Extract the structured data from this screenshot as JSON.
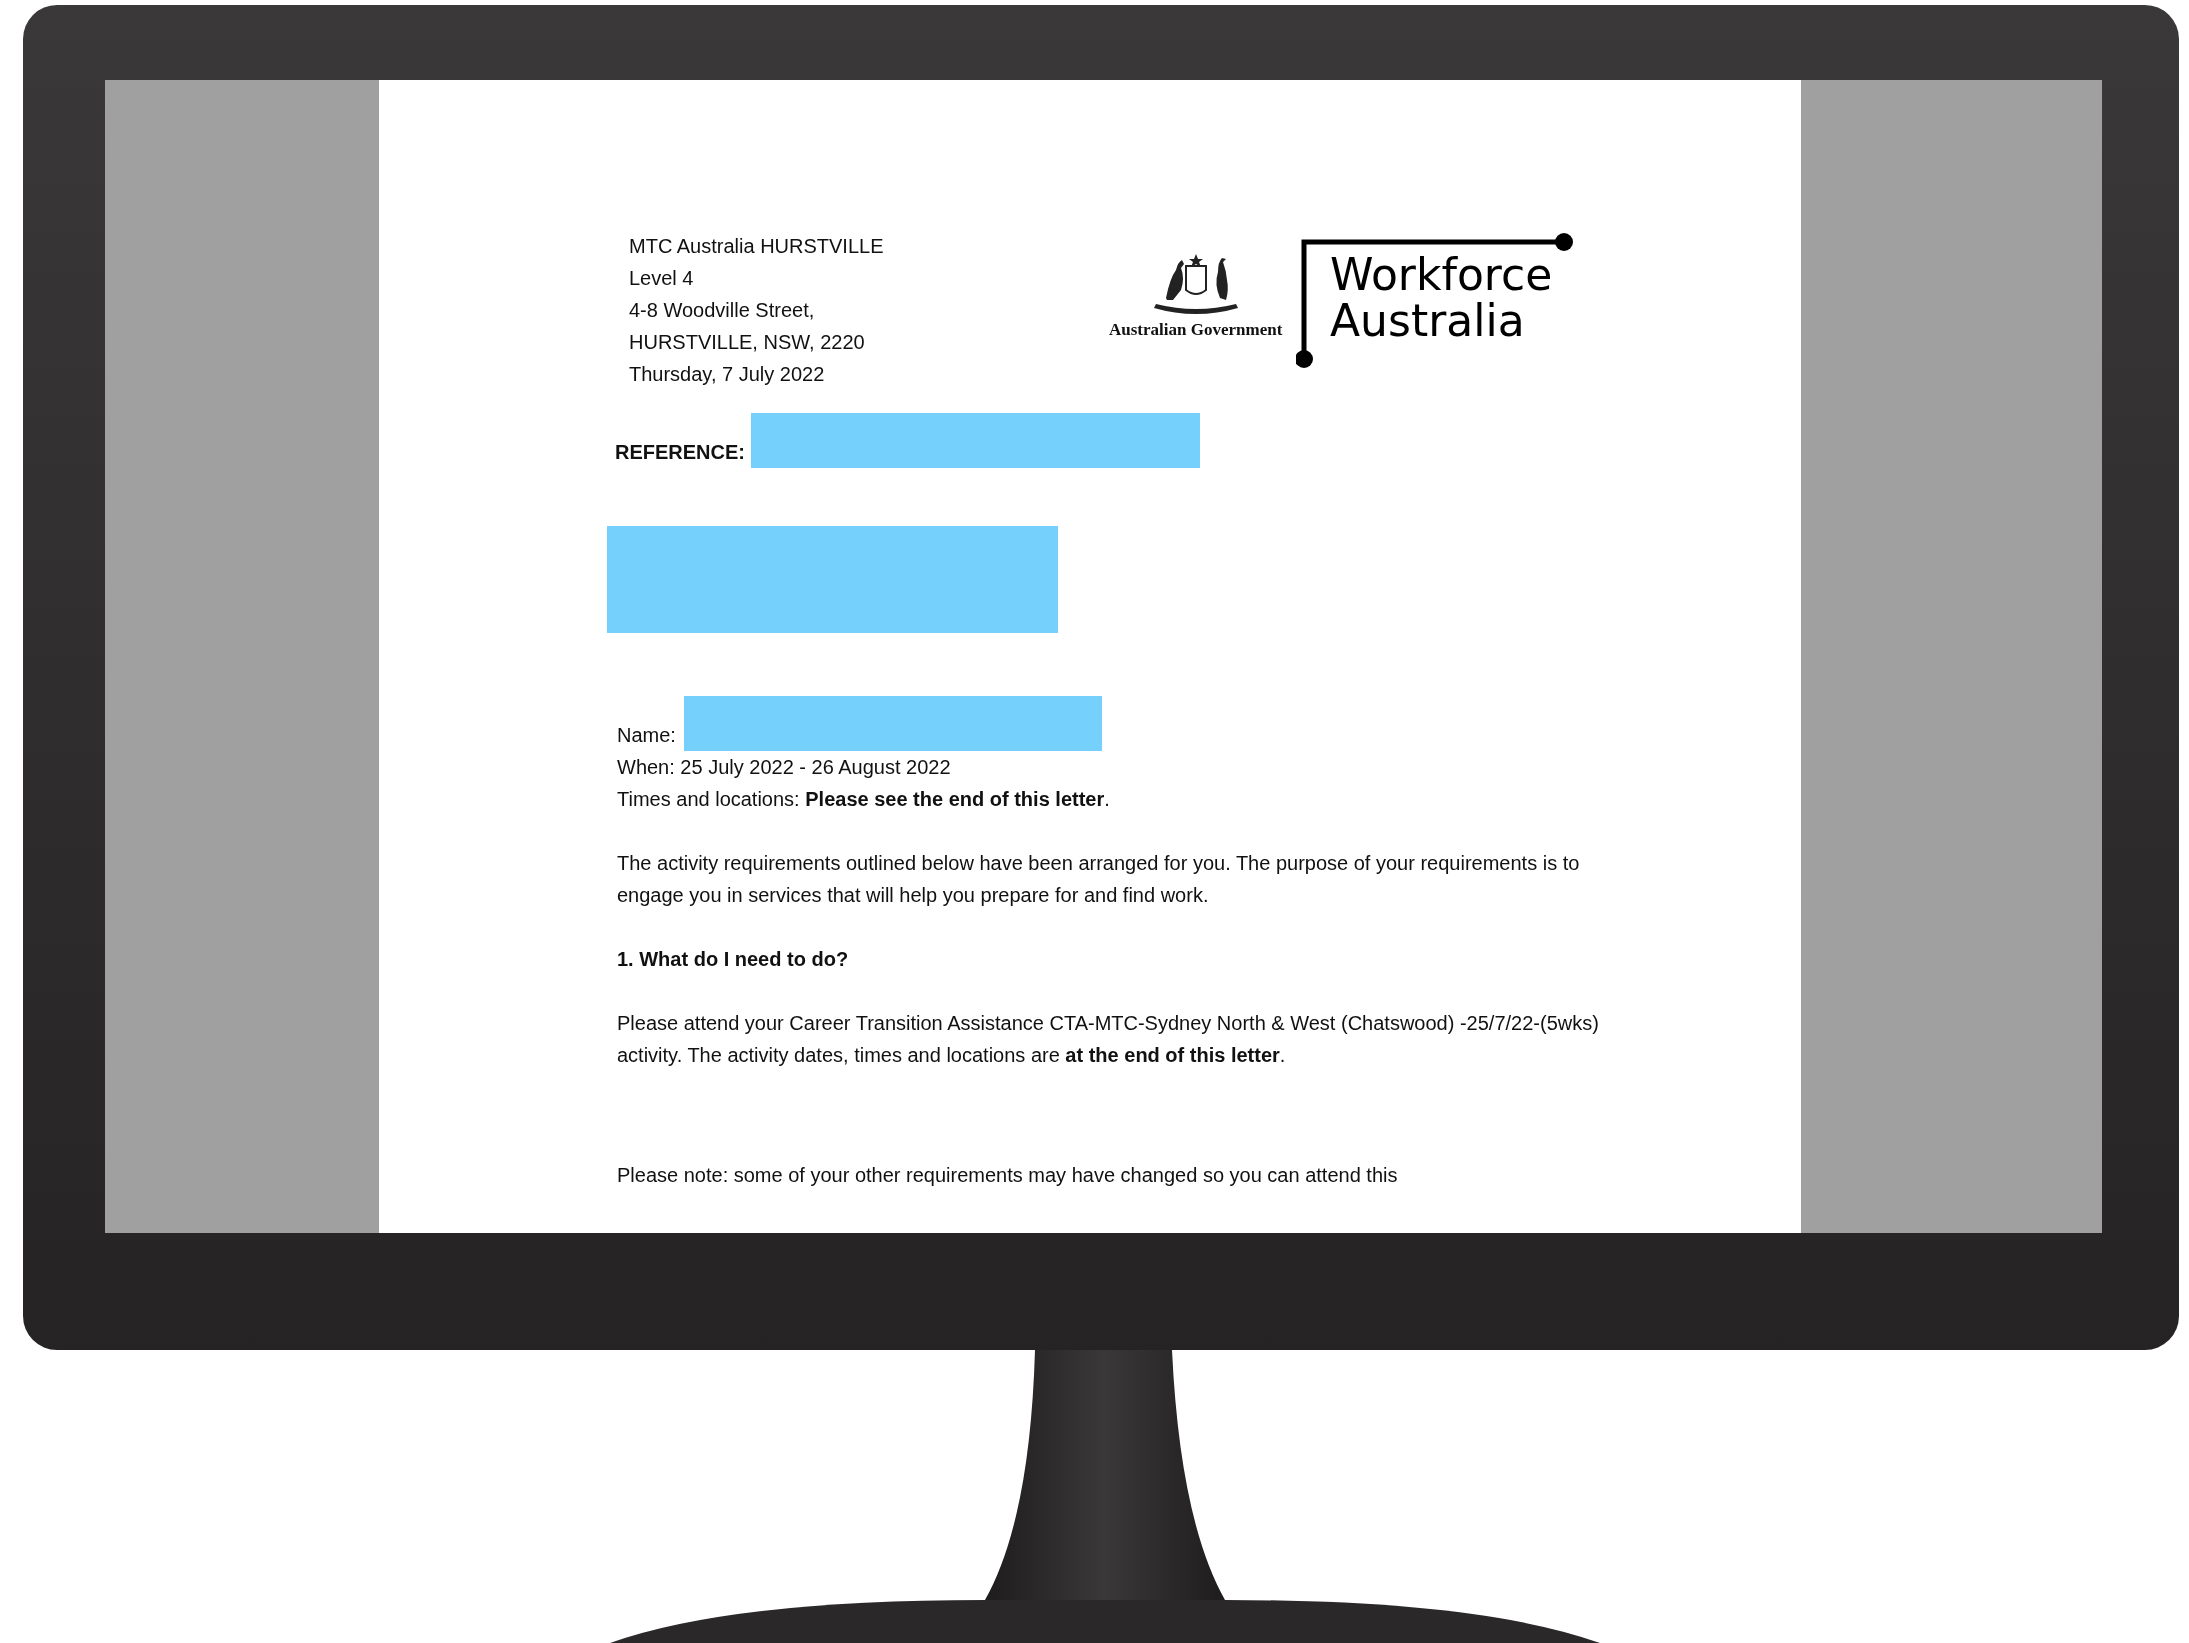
{
  "document": {
    "sender_lines": [
      "MTC Australia HURSTVILLE",
      "Level 4",
      "4-8 Woodville Street,",
      "HURSTVILLE, NSW, 2220",
      "Thursday, 7 July 2022"
    ],
    "government_logo_text": "Australian Government",
    "brand_logo_lines": [
      "Workforce",
      "Australia"
    ],
    "reference_label": "REFERENCE:",
    "name_label": "Name:",
    "when": "When: 25 July 2022 - 26 August 2022",
    "times": "Times and locations: **Please see the end of this letter**.",
    "intro": "The activity requirements outlined below have been arranged for you. The purpose of your requirements is to engage you in services that will help you prepare for and find work.",
    "heading": "1. What do I need to do?",
    "instruction": "Please attend your Career Transition Assistance CTA-MTC-Sydney North & West (Chatswood) -25/7/22-(5wks) activity. The activity dates, times and locations are **at the end of this letter**.",
    "note": "Please note: some of your other requirements may have changed so you can attend this"
  }
}
